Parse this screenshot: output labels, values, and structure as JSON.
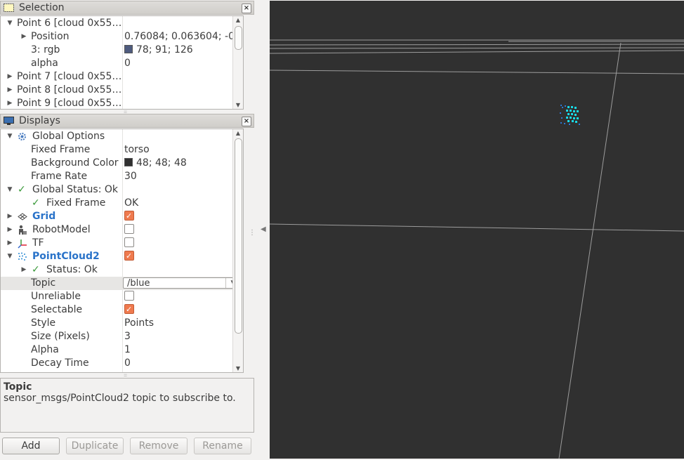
{
  "selection": {
    "title": "Selection",
    "rows": [
      {
        "name": "Point 6 [cloud 0x55…",
        "value": ""
      },
      {
        "name": "Position",
        "value": "0.76084; 0.063604; -0.…"
      },
      {
        "name": "3: rgb",
        "value": "78; 91; 126",
        "swatch": "#4e5b7e"
      },
      {
        "name": "alpha",
        "value": "0"
      },
      {
        "name": "Point 7 [cloud 0x55…",
        "value": ""
      },
      {
        "name": "Point 8 [cloud 0x55…",
        "value": ""
      },
      {
        "name": "Point 9 [cloud 0x55…",
        "value": ""
      }
    ]
  },
  "displays": {
    "title": "Displays",
    "rows": [
      {
        "name": "Global Options",
        "value": ""
      },
      {
        "name": "Fixed Frame",
        "value": "torso"
      },
      {
        "name": "Background Color",
        "value": "48; 48; 48",
        "swatch": "#303030"
      },
      {
        "name": "Frame Rate",
        "value": "30"
      },
      {
        "name": "Global Status: Ok",
        "value": ""
      },
      {
        "name": "Fixed Frame",
        "value": "OK"
      },
      {
        "name": "Grid",
        "checked": true
      },
      {
        "name": "RobotModel",
        "checked": false
      },
      {
        "name": "TF",
        "checked": false
      },
      {
        "name": "PointCloud2",
        "checked": true
      },
      {
        "name": "Status: Ok",
        "value": ""
      },
      {
        "name": "Topic",
        "value": "/blue"
      },
      {
        "name": "Unreliable",
        "checked": false
      },
      {
        "name": "Selectable",
        "checked": true
      },
      {
        "name": "Style",
        "value": "Points"
      },
      {
        "name": "Size (Pixels)",
        "value": "3"
      },
      {
        "name": "Alpha",
        "value": "1"
      },
      {
        "name": "Decay Time",
        "value": "0"
      }
    ]
  },
  "description": {
    "title": "Topic",
    "text": "sensor_msgs/PointCloud2 topic to subscribe to."
  },
  "buttons": {
    "add": "Add",
    "duplicate": "Duplicate",
    "remove": "Remove",
    "rename": "Rename"
  },
  "colors": {
    "viewport_background": "#303030",
    "grid_line": "#a0a0a0",
    "point_cloud": "#18d9e6",
    "accent_check": "#ef7a4e",
    "highlight_text": "#2a73c9"
  }
}
